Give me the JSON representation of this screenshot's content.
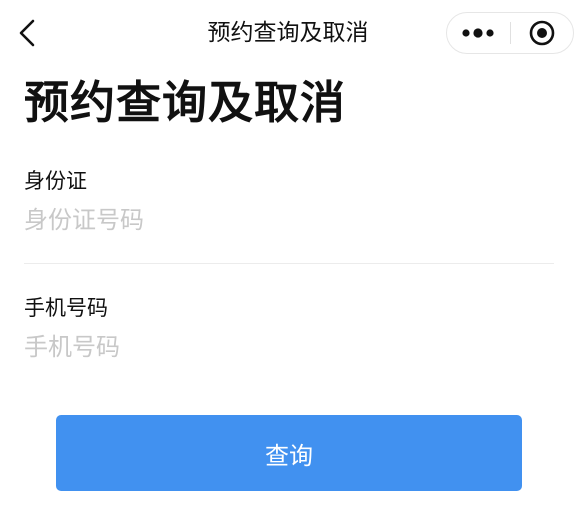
{
  "navbar": {
    "title": "预约查询及取消",
    "back_icon": "chevron-left-icon",
    "more_icon": "more-dots-icon",
    "close_icon": "target-circle-icon"
  },
  "page": {
    "title": "预约查询及取消"
  },
  "form": {
    "id_card": {
      "label": "身份证",
      "placeholder": "身份证号码",
      "value": ""
    },
    "phone": {
      "label": "手机号码",
      "placeholder": "手机号码",
      "value": ""
    }
  },
  "actions": {
    "query_label": "查询"
  },
  "colors": {
    "primary": "#4191f0",
    "placeholder": "#c8c8c8",
    "text": "#111111",
    "divider": "#ececec"
  }
}
